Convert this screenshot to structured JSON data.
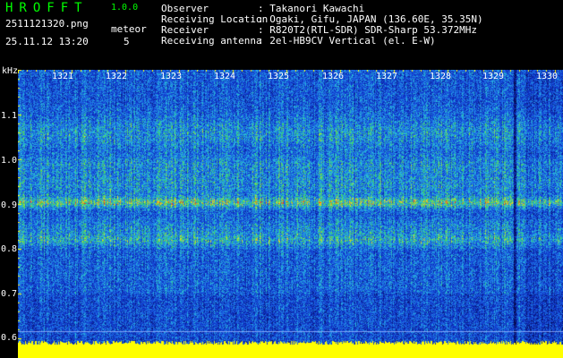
{
  "app": {
    "logo": "HROFFT",
    "version": "1.0.0"
  },
  "capture": {
    "file_name": "2511121320.png",
    "date_time": "25.11.12 13:20",
    "meteor_label": "meteor",
    "meteor_count": "5"
  },
  "metadata": [
    {
      "key": "Observer",
      "value": ": Takanori Kawachi"
    },
    {
      "key": "Receiving Location",
      "value": ": Ogaki, Gifu, JAPAN (136.60E, 35.35N)"
    },
    {
      "key": "Receiver",
      "value": ": R820T2(RTL-SDR) SDR-Sharp 53.372MHz"
    },
    {
      "key": "Receiving antenna",
      "value": ": 2el-HB9CV Vertical (el. E-W)"
    }
  ],
  "axes": {
    "y_unit": "kHz",
    "x_ticks": [
      "1321",
      "1322",
      "1323",
      "1324",
      "1325",
      "1326",
      "1327",
      "1328",
      "1329",
      "1330"
    ],
    "y_ticks": [
      "1.1",
      "1.0",
      "0.9",
      "0.8",
      "0.7",
      "0.6"
    ]
  },
  "colors": {
    "background": "#000000",
    "tick_marks": "#ffff00",
    "header_accent": "#00ff00",
    "text": "#ffffff",
    "noise_floor_band": "#ffff00",
    "signal_peak": "#ff3020",
    "waterfall_base": "#0a2a9a"
  }
}
